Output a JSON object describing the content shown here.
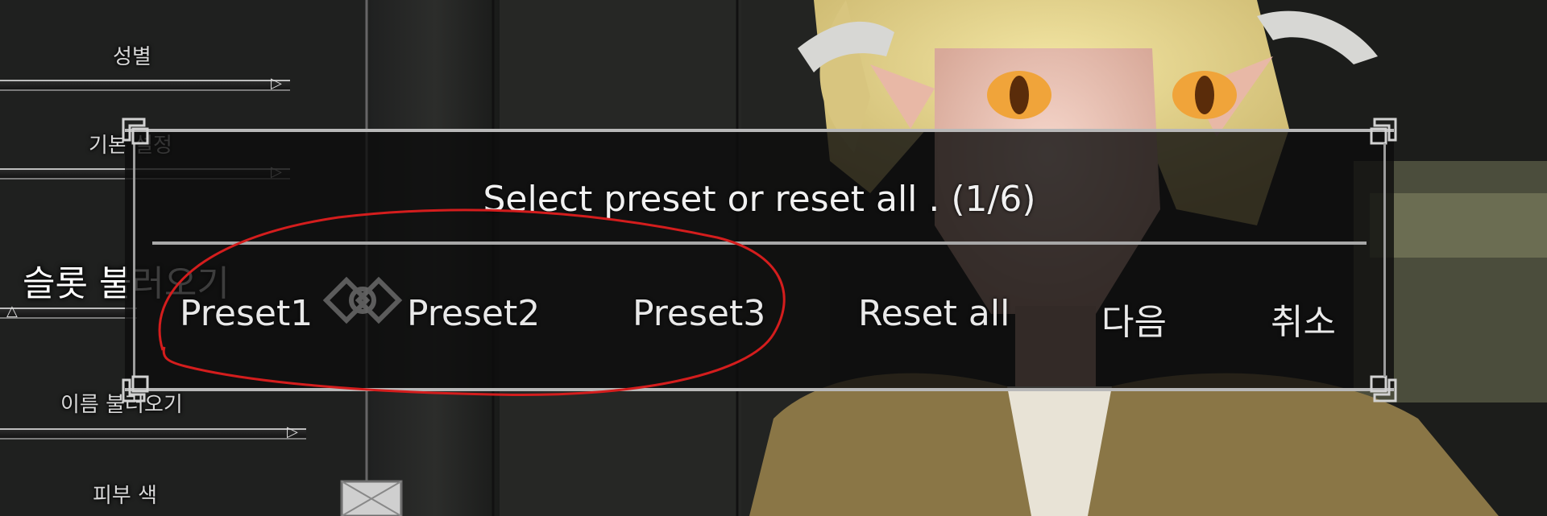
{
  "colors": {
    "annotation": "#d41d1d",
    "dialog_border": "#b8b8b8",
    "text": "#e9e9e9"
  },
  "sliders": {
    "gender_label": "성별",
    "base_label": "기본 설정",
    "slot_title": "슬롯 불러오기",
    "name_label": "이름 불러오기",
    "skin_label": "피부 색"
  },
  "dialog": {
    "title": "Select preset or reset all . (1/6)",
    "buttons": {
      "preset1": "Preset1",
      "preset2": "Preset2",
      "preset3": "Preset3",
      "reset_all": "Reset all",
      "next": "다음",
      "cancel": "취소"
    }
  },
  "icons": {
    "corners": "celtic-corner-icon",
    "knot": "celtic-knot-icon",
    "slider_cap": "arrow-cap-icon"
  }
}
